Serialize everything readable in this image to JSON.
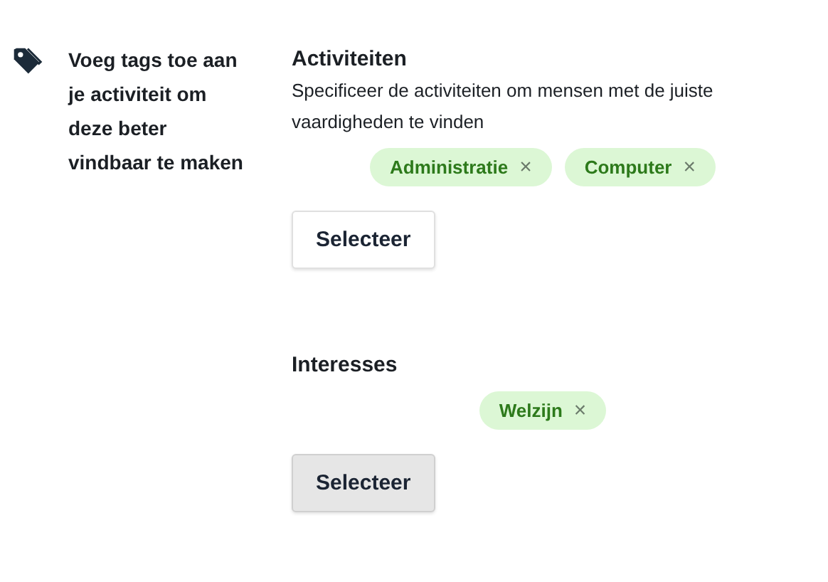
{
  "intro": "Voeg tags toe aan je activiteit om deze beter vindbaar te maken",
  "sections": [
    {
      "title": "Activiteiten",
      "description": "Specificeer de activiteiten om mensen met de juiste vaardigheden te vinden",
      "tags": [
        {
          "label": "Administratie",
          "remove": "×"
        },
        {
          "label": "Computer",
          "remove": "×"
        }
      ],
      "button": {
        "label": "Selecteer",
        "highlighted": false
      }
    },
    {
      "title": "Interesses",
      "tags": [
        {
          "label": "Welzijn",
          "remove": "×"
        }
      ],
      "button": {
        "label": "Selecteer",
        "highlighted": true
      }
    }
  ]
}
